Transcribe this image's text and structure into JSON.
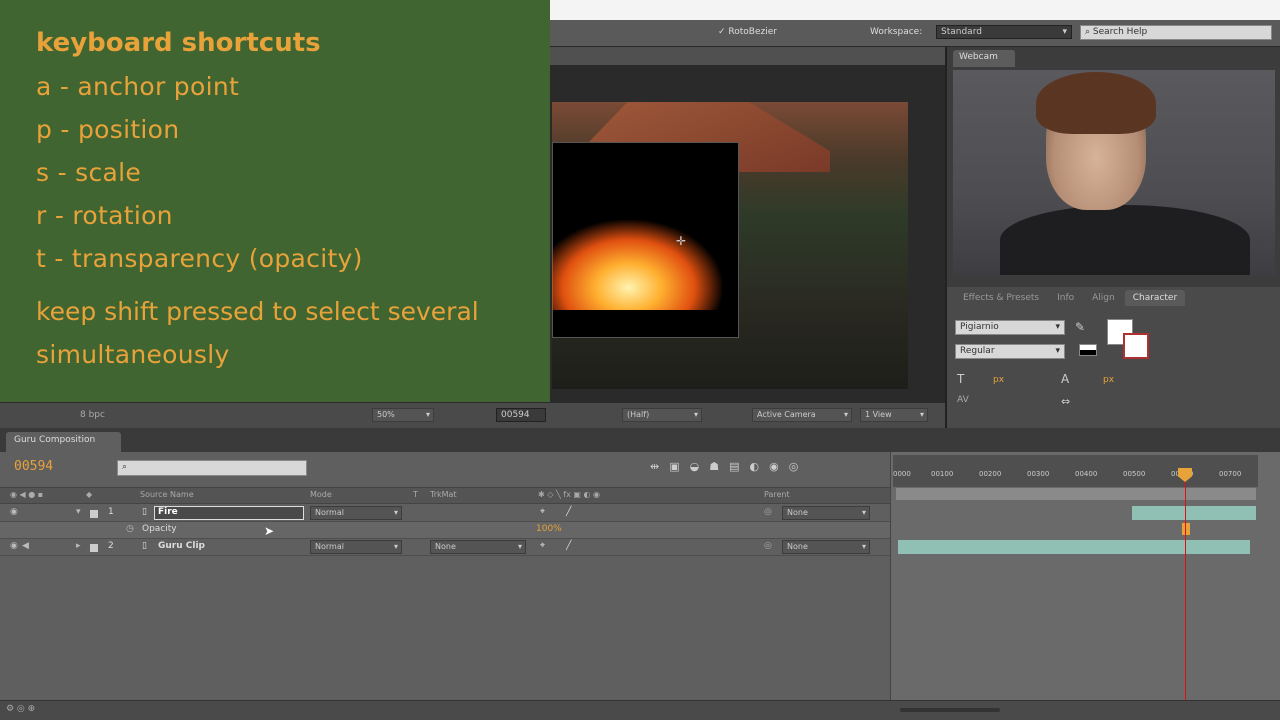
{
  "overlay": {
    "title": "keyboard shortcuts",
    "shortcuts": [
      "a - anchor point",
      "p - position",
      "s - scale",
      "r - rotation",
      "t - transparency (opacity)"
    ],
    "note_line1": "keep shift pressed to select several",
    "note_line2": "simultaneously"
  },
  "toolbar": {
    "rotobezier_label": "RotoBezier",
    "workspace_label": "Workspace:",
    "workspace_value": "Standard",
    "search_placeholder": "Search Help"
  },
  "viewer": {
    "zoom": "50%",
    "timecode": "00594",
    "resolution": "(Half)",
    "camera": "Active Camera",
    "views": "1 View"
  },
  "webcam": {
    "tab_label": "Webcam"
  },
  "character_panel": {
    "tabs": [
      "Effects & Presets",
      "Info",
      "Align",
      "Character"
    ],
    "active_tab": "Character",
    "font_name": "Pigiarnio",
    "font_style": "Regular",
    "size_unit": "px",
    "leading_unit": "px"
  },
  "project_bar": {
    "bpc_label": "8 bpc"
  },
  "timeline": {
    "tab_label": "Guru Composition",
    "timecode": "00594",
    "search_placeholder": "",
    "columns": {
      "source_name": "Source Name",
      "mode": "Mode",
      "t": "T",
      "trkmat": "TrkMat",
      "parent": "Parent"
    },
    "layers": [
      {
        "number": "1",
        "name": "Fire",
        "mode": "Normal",
        "trkmat": "",
        "parent": "None"
      },
      {
        "number": "2",
        "name": "Guru Clip",
        "mode": "Normal",
        "trkmat": "None",
        "parent": "None"
      }
    ],
    "property_name": "Opacity",
    "property_value": "100%",
    "ruler_ticks": [
      "0000",
      "00100",
      "00200",
      "00300",
      "00400",
      "00500",
      "00600",
      "00700"
    ]
  },
  "colors": {
    "overlay_bg": "#416530",
    "overlay_text": "#e8a23a",
    "timecode": "#e8a23a",
    "layer_bar": "#8fc0b3",
    "cti": "#e01010"
  }
}
